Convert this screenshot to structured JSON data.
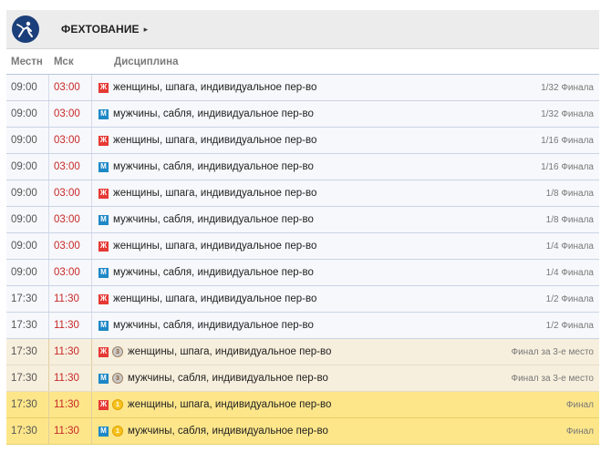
{
  "header": {
    "sport_title": "ФЕХТОВАНИЕ",
    "sport_icon": "fencing-icon",
    "caret": "▸"
  },
  "columns": {
    "local": "Местн",
    "msk": "Мск",
    "discipline": "Дисциплина"
  },
  "colors": {
    "header_bg": "#ececec",
    "accent_time": "#c62828",
    "female": "#e53935",
    "male": "#1e88c7",
    "bronze_row": "#f7efdd",
    "gold_row": "#fde68a"
  },
  "events": [
    {
      "local": "09:00",
      "msk": "03:00",
      "gender": "Ж",
      "gclass": "f",
      "medal": "",
      "discipline": "женщины, шпага, индивидуальное пер-во",
      "stage": "1/32 Финала",
      "rowtype": "normal"
    },
    {
      "local": "09:00",
      "msk": "03:00",
      "gender": "М",
      "gclass": "m",
      "medal": "",
      "discipline": "мужчины, сабля, индивидуальное пер-во",
      "stage": "1/32 Финала",
      "rowtype": "normal"
    },
    {
      "local": "09:00",
      "msk": "03:00",
      "gender": "Ж",
      "gclass": "f",
      "medal": "",
      "discipline": "женщины, шпага, индивидуальное пер-во",
      "stage": "1/16 Финала",
      "rowtype": "normal"
    },
    {
      "local": "09:00",
      "msk": "03:00",
      "gender": "М",
      "gclass": "m",
      "medal": "",
      "discipline": "мужчины, сабля, индивидуальное пер-во",
      "stage": "1/16 Финала",
      "rowtype": "normal"
    },
    {
      "local": "09:00",
      "msk": "03:00",
      "gender": "Ж",
      "gclass": "f",
      "medal": "",
      "discipline": "женщины, шпага, индивидуальное пер-во",
      "stage": "1/8 Финала",
      "rowtype": "normal"
    },
    {
      "local": "09:00",
      "msk": "03:00",
      "gender": "М",
      "gclass": "m",
      "medal": "",
      "discipline": "мужчины, сабля, индивидуальное пер-во",
      "stage": "1/8 Финала",
      "rowtype": "normal"
    },
    {
      "local": "09:00",
      "msk": "03:00",
      "gender": "Ж",
      "gclass": "f",
      "medal": "",
      "discipline": "женщины, шпага, индивидуальное пер-во",
      "stage": "1/4 Финала",
      "rowtype": "normal"
    },
    {
      "local": "09:00",
      "msk": "03:00",
      "gender": "М",
      "gclass": "m",
      "medal": "",
      "discipline": "мужчины, сабля, индивидуальное пер-во",
      "stage": "1/4 Финала",
      "rowtype": "normal"
    },
    {
      "local": "17:30",
      "msk": "11:30",
      "gender": "Ж",
      "gclass": "f",
      "medal": "",
      "discipline": "женщины, шпага, индивидуальное пер-во",
      "stage": "1/2 Финала",
      "rowtype": "normal"
    },
    {
      "local": "17:30",
      "msk": "11:30",
      "gender": "М",
      "gclass": "m",
      "medal": "",
      "discipline": "мужчины, сабля, индивидуальное пер-во",
      "stage": "1/2 Финала",
      "rowtype": "normal"
    },
    {
      "local": "17:30",
      "msk": "11:30",
      "gender": "Ж",
      "gclass": "f",
      "medal": "bronze",
      "discipline": "женщины, шпага, индивидуальное пер-во",
      "stage": "Финал за 3-е место",
      "rowtype": "bronze"
    },
    {
      "local": "17:30",
      "msk": "11:30",
      "gender": "М",
      "gclass": "m",
      "medal": "bronze",
      "discipline": "мужчины, сабля, индивидуальное пер-во",
      "stage": "Финал за 3-е место",
      "rowtype": "bronze"
    },
    {
      "local": "17:30",
      "msk": "11:30",
      "gender": "Ж",
      "gclass": "f",
      "medal": "gold",
      "discipline": "женщины, шпага, индивидуальное пер-во",
      "stage": "Финал",
      "rowtype": "gold"
    },
    {
      "local": "17:30",
      "msk": "11:30",
      "gender": "М",
      "gclass": "m",
      "medal": "gold",
      "discipline": "мужчины, сабля, индивидуальное пер-во",
      "stage": "Финал",
      "rowtype": "gold"
    }
  ]
}
